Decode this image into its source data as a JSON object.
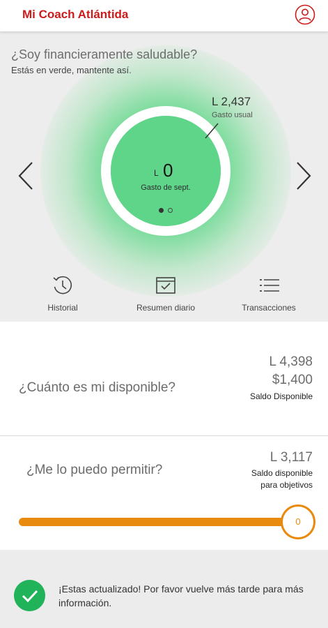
{
  "app": {
    "title": "Mi Coach Atlántida"
  },
  "hero": {
    "question": "¿Soy financieramente saludable?",
    "status": "Estás en verde, mantente así.",
    "usual_value": "L  2,437",
    "usual_label": "Gasto usual",
    "currency": "L",
    "spent_value": "0",
    "spent_label": "Gasto de sept.",
    "page_indicator": {
      "current": 1,
      "total": 2
    }
  },
  "actions": [
    {
      "label": "Historial",
      "icon": "history-clock-icon"
    },
    {
      "label": "Resumen diario",
      "icon": "calendar-check-icon"
    },
    {
      "label": "Transacciones",
      "icon": "list-icon"
    }
  ],
  "available": {
    "question": "¿Cuánto es mi disponible?",
    "value_local": "L  4,398",
    "value_usd": "$1,400",
    "label": "Saldo Disponible"
  },
  "afford": {
    "question": "¿Me lo puedo permitir?",
    "value": "L  3,117",
    "label_line1": "Saldo disponible",
    "label_line2": "para objetivos",
    "slider_value": "0"
  },
  "footer": {
    "message": "¡Estas actualizado! Por favor vuelve más tarde para más información."
  },
  "colors": {
    "brand_red": "#cc1b1b",
    "healthy_green": "#5fd58a",
    "slider_orange": "#e88a0e",
    "ok_green": "#21b35a"
  }
}
